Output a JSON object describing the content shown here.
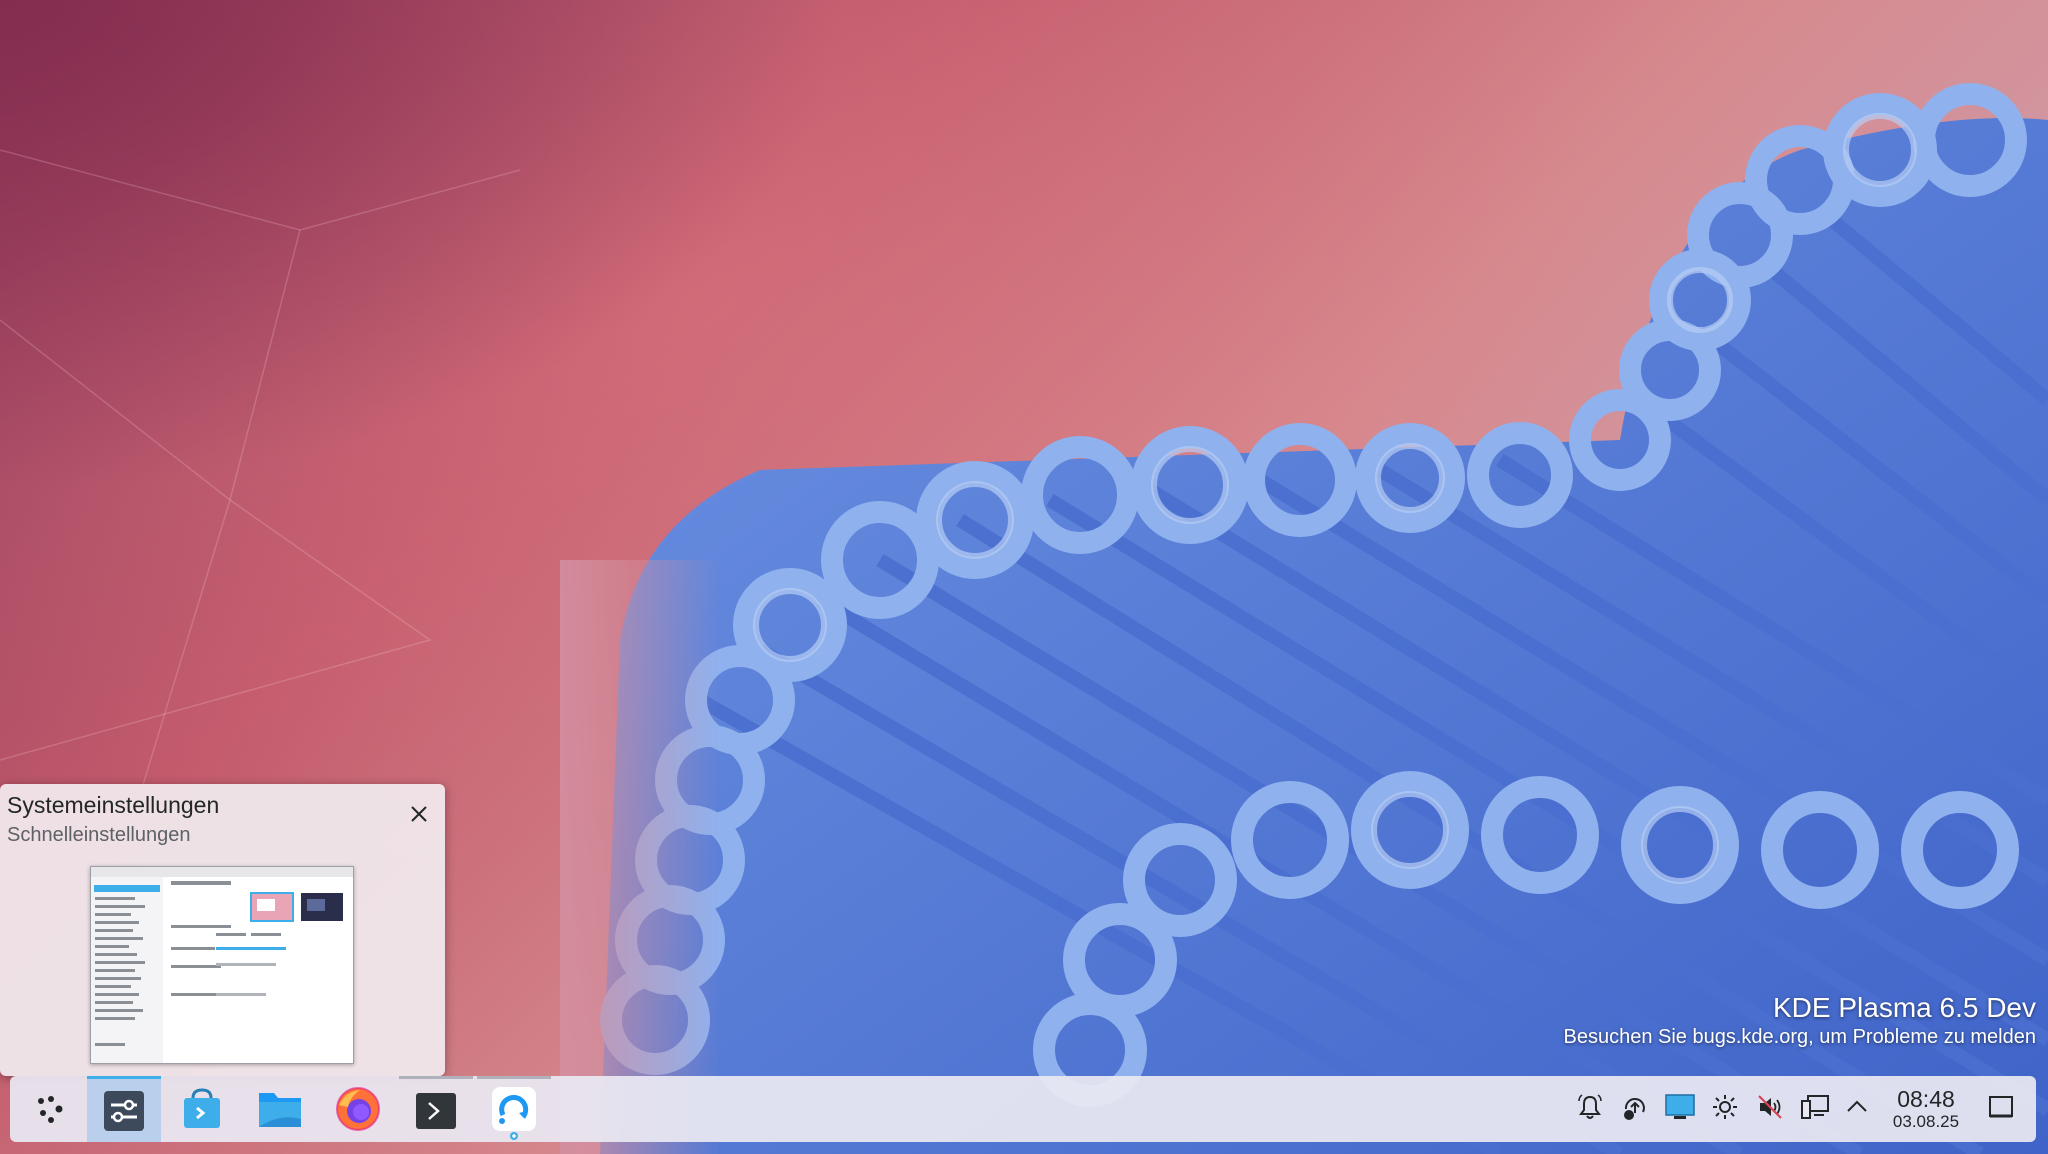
{
  "desktop": {
    "watermark_title": "KDE Plasma 6.5 Dev",
    "watermark_subtitle": "Besuchen Sie bugs.kde.org, um Probleme zu melden"
  },
  "task_tooltip": {
    "title": "Systemeinstellungen",
    "subtitle": "Schnelleinstellungen"
  },
  "taskbar": {
    "tasks": [
      {
        "name": "application-launcher",
        "icon": "kde-launcher-icon"
      },
      {
        "name": "systemeinstellungen",
        "icon": "system-settings-icon",
        "active": true
      },
      {
        "name": "discover",
        "icon": "discover-store-icon"
      },
      {
        "name": "dolphin",
        "icon": "folder-icon"
      },
      {
        "name": "firefox",
        "icon": "firefox-icon"
      },
      {
        "name": "konsole",
        "icon": "terminal-icon"
      },
      {
        "name": "updater",
        "icon": "sync-icon"
      }
    ]
  },
  "system_tray": {
    "icons": [
      "notifications-icon",
      "updates-icon",
      "display-icon",
      "brightness-icon",
      "volume-muted-icon",
      "network-icon",
      "expand-tray-icon"
    ],
    "time": "08:48",
    "date": "03.08.25"
  },
  "colors": {
    "accent": "#3daee9",
    "panel": "#e9e8f2",
    "ribbon": "#5d86dc"
  }
}
